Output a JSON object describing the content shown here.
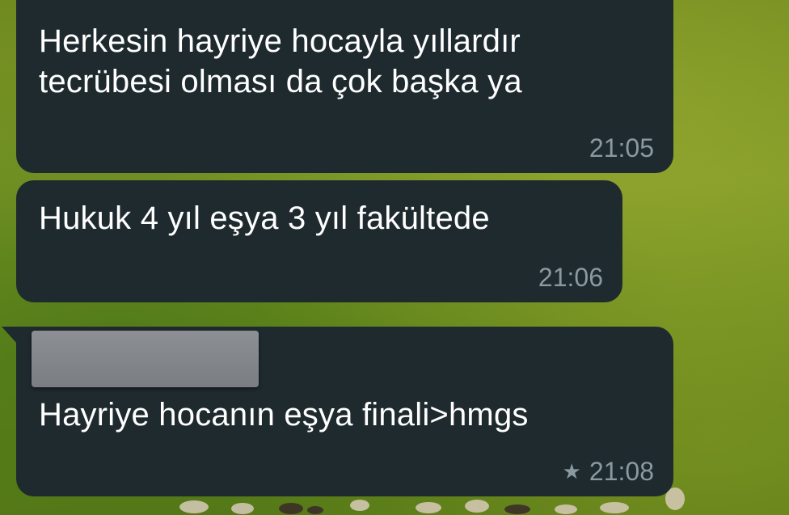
{
  "background": {
    "wallpaper_color": "#6f8a1f",
    "description_icon": "meadow-wallpaper-icon"
  },
  "messages": [
    {
      "text": "Herkesin hayriye hocayla yıllardır\ntecrübesi olması da çok başka ya",
      "line1": "Herkesin hayriye hocayla yıllardır",
      "line2": "tecrübesi olması da çok başka ya",
      "time": "21:05"
    },
    {
      "text": "Hukuk 4 yıl eşya 3 yıl fakültede",
      "time": "21:06"
    },
    {
      "text": "Hayriye hocanın eşya finali>hmgs",
      "time": "21:08",
      "starred": true,
      "star_icon": "★"
    }
  ],
  "colors": {
    "bubble_bg": "#1f2a2f",
    "text": "#ffffff",
    "meta": "#8a9aa0"
  }
}
